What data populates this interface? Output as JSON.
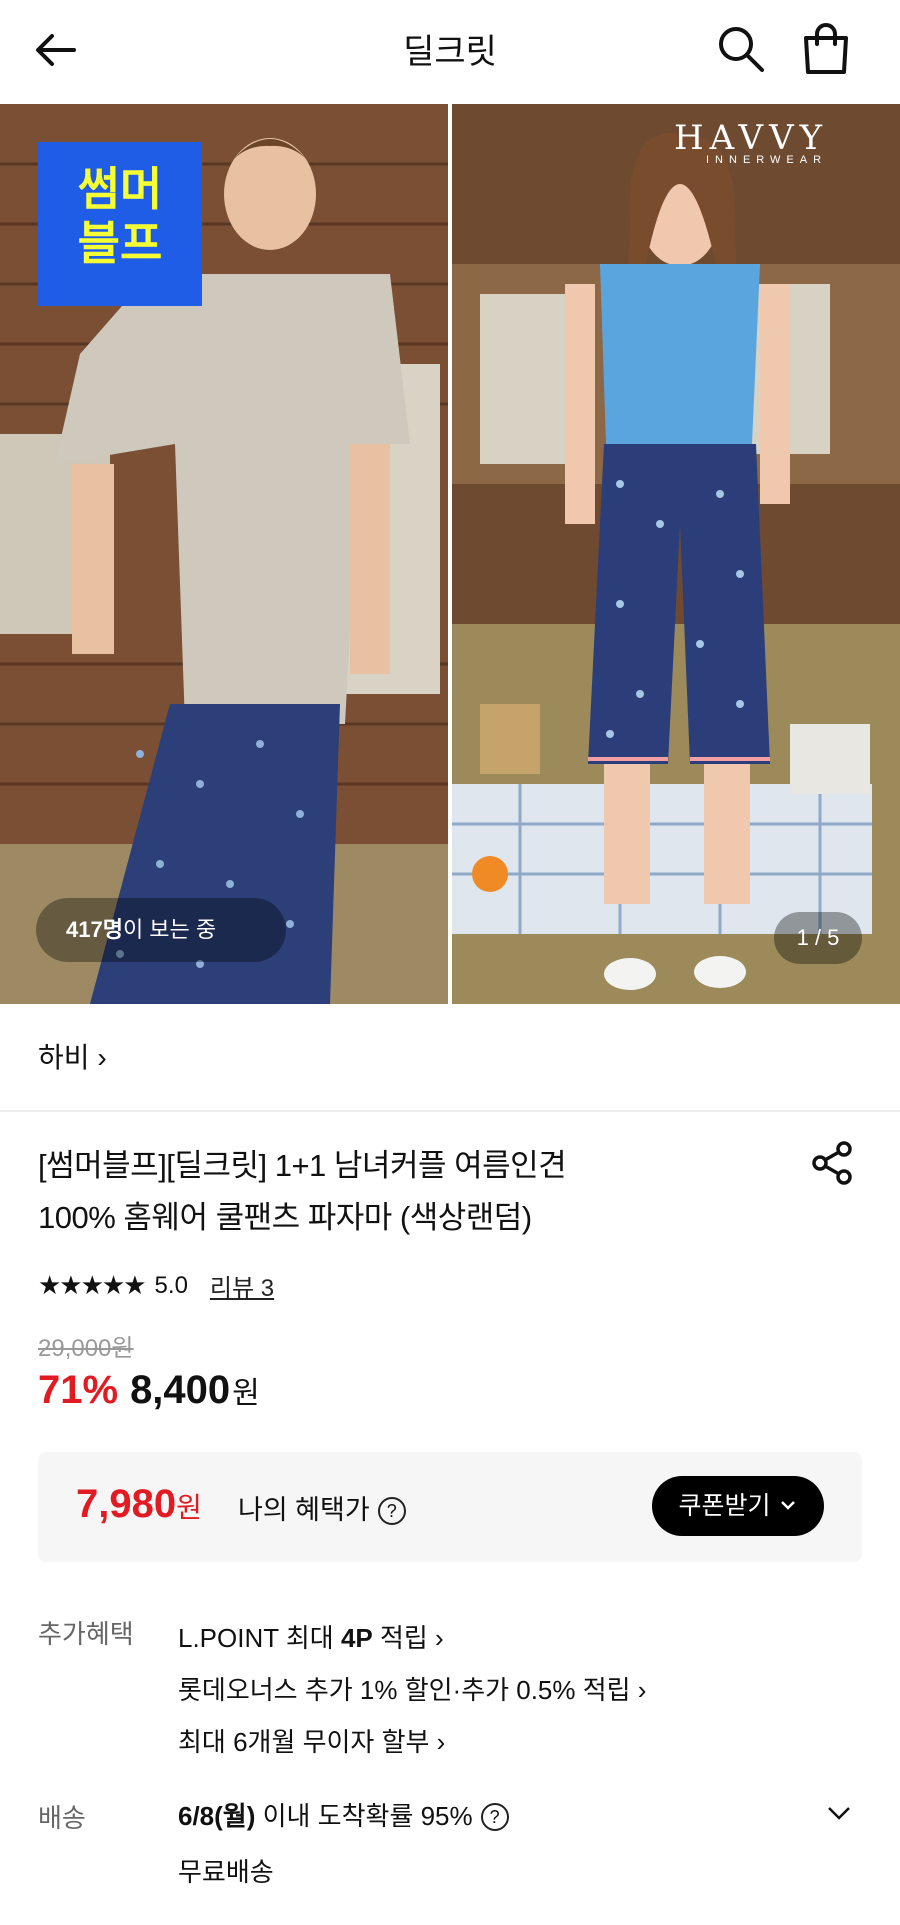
{
  "header": {
    "title": "딜크릿",
    "icons": [
      "back-arrow-icon",
      "search-icon",
      "shopping-bag-icon"
    ]
  },
  "hero": {
    "badge_line1": "썸머",
    "badge_line2": "블프",
    "brand_logo": "HAVVY",
    "brand_logo_sub": "INNERWEAR",
    "viewers_count": "417명",
    "viewers_suffix": "이 보는 중",
    "pager": "1 / 5"
  },
  "brand": {
    "name": "하비",
    "chevron": "›"
  },
  "product": {
    "title_line1": "[썸머블프][딜크릿] 1+1 남녀커플 여름인견",
    "title_line2": "100% 홈웨어 쿨팬츠 파자마 (색상랜덤)",
    "stars": "★★★★★",
    "rating": "5.0",
    "reviews": "리뷰 3",
    "original_price": "29,000원",
    "discount": "71%",
    "price": "8,400",
    "price_unit": "원"
  },
  "benefit": {
    "price": "7,980",
    "price_unit": "원",
    "label": "나의 혜택가",
    "coupon_button": "쿠폰받기"
  },
  "extra": {
    "label": "추가혜택",
    "lines": [
      {
        "pre": "L.POINT 최대 ",
        "bold": "4P",
        "post": " 적립 ›"
      },
      {
        "pre": "롯데오너스 추가 1% 할인·추가 0.5% 적립 ›",
        "bold": "",
        "post": ""
      },
      {
        "pre": "최대 6개월 무이자 할부 ›",
        "bold": "",
        "post": ""
      }
    ]
  },
  "shipping": {
    "label": "배송",
    "date": "6/8(월)",
    "text": " 이내 도착확률 95%",
    "sub": "무료배송"
  },
  "colors": {
    "accent_red": "#e21b23",
    "badge_blue": "#1f5de6",
    "badge_text": "#f6ff33"
  }
}
